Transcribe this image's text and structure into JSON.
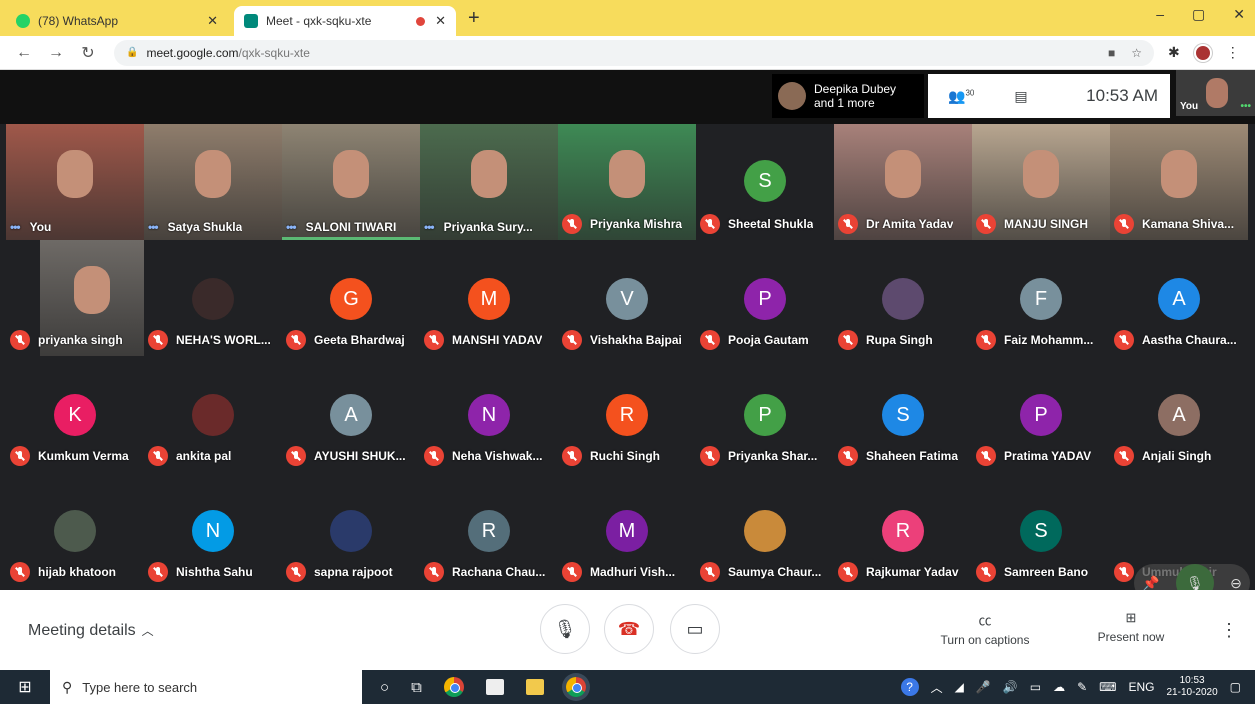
{
  "browser": {
    "tabs": [
      {
        "title": "(78) WhatsApp",
        "close": "✕",
        "color": "#25d366"
      },
      {
        "title": "Meet - qxk-sqku-xte",
        "close": "✕",
        "color": "#00897b"
      }
    ],
    "new_tab": "+",
    "url_host": "meet.google.com",
    "url_path": "/qxk-sqku-xte",
    "window_controls": [
      "–",
      "▢",
      "✕"
    ]
  },
  "meet": {
    "presenter_text": "Deepika Dubey and 1 more",
    "participants_count": "30",
    "time": "10:53 AM",
    "self_label": "You",
    "tiles": [
      {
        "name": "You",
        "type": "video",
        "bg": "#a0584a",
        "indicator": "dots"
      },
      {
        "name": "Satya Shukla",
        "type": "video",
        "bg": "#8f7d6c",
        "indicator": "dots"
      },
      {
        "name": "SALONI TIWARI",
        "type": "video",
        "bg": "#8e8473",
        "indicator": "dots",
        "speaking": true
      },
      {
        "name": "Priyanka Sury...",
        "type": "video",
        "bg": "#4c6b4e",
        "indicator": "dots"
      },
      {
        "name": "Priyanka Mishra",
        "type": "video",
        "bg": "#3e8a55",
        "indicator": "mute"
      },
      {
        "name": "Sheetal Shukla",
        "type": "avatar",
        "letter": "S",
        "color": "#43a047",
        "indicator": "mute"
      },
      {
        "name": "Dr Amita Yadav",
        "type": "video",
        "bg": "#a8817a",
        "indicator": "mute"
      },
      {
        "name": "MANJU SINGH",
        "type": "video",
        "bg": "#b8a690",
        "indicator": "mute"
      },
      {
        "name": "Kamana Shiva...",
        "type": "video",
        "bg": "#9e8b76",
        "indicator": "mute"
      },
      {
        "name": "priyanka singh",
        "type": "video",
        "bg": "#6e6a66",
        "indicator": "mute"
      },
      {
        "name": "NEHA'S WORL...",
        "type": "photo",
        "color": "#3a2a2a",
        "indicator": "mute"
      },
      {
        "name": "Geeta Bhardwaj",
        "type": "avatar",
        "letter": "G",
        "color": "#f4511e",
        "indicator": "mute"
      },
      {
        "name": "MANSHI YADAV",
        "type": "avatar",
        "letter": "M",
        "color": "#f4511e",
        "indicator": "mute"
      },
      {
        "name": "Vishakha Bajpai",
        "type": "avatar",
        "letter": "V",
        "color": "#78909c",
        "indicator": "mute"
      },
      {
        "name": "Pooja Gautam",
        "type": "avatar",
        "letter": "P",
        "color": "#8e24aa",
        "indicator": "mute"
      },
      {
        "name": "Rupa Singh",
        "type": "photo",
        "color": "#5d4a6e",
        "indicator": "mute"
      },
      {
        "name": "Faiz Mohamm...",
        "type": "avatar",
        "letter": "F",
        "color": "#78909c",
        "indicator": "mute"
      },
      {
        "name": "Aastha Chaura...",
        "type": "avatar",
        "letter": "A",
        "color": "#1e88e5",
        "indicator": "mute"
      },
      {
        "name": "Kumkum Verma",
        "type": "avatar",
        "letter": "K",
        "color": "#e91e63",
        "indicator": "mute"
      },
      {
        "name": "ankita pal",
        "type": "photo",
        "color": "#6a2a2a",
        "indicator": "mute"
      },
      {
        "name": "AYUSHI SHUK...",
        "type": "avatar",
        "letter": "A",
        "color": "#78909c",
        "indicator": "mute"
      },
      {
        "name": "Neha Vishwak...",
        "type": "avatar",
        "letter": "N",
        "color": "#8e24aa",
        "indicator": "mute"
      },
      {
        "name": "Ruchi Singh",
        "type": "avatar",
        "letter": "R",
        "color": "#f4511e",
        "indicator": "mute"
      },
      {
        "name": "Priyanka Shar...",
        "type": "avatar",
        "letter": "P",
        "color": "#43a047",
        "indicator": "mute"
      },
      {
        "name": "Shaheen Fatima",
        "type": "avatar",
        "letter": "S",
        "color": "#1e88e5",
        "indicator": "mute"
      },
      {
        "name": "Pratima YADAV",
        "type": "avatar",
        "letter": "P",
        "color": "#8e24aa",
        "indicator": "mute"
      },
      {
        "name": "Anjali Singh",
        "type": "avatar",
        "letter": "A",
        "color": "#8d6e63",
        "indicator": "mute"
      },
      {
        "name": "hijab khatoon",
        "type": "photo",
        "color": "#4d5a4d",
        "indicator": "mute"
      },
      {
        "name": "Nishtha Sahu",
        "type": "avatar",
        "letter": "N",
        "color": "#039be5",
        "indicator": "mute"
      },
      {
        "name": "sapna rajpoot",
        "type": "photo",
        "color": "#2a3a6a",
        "indicator": "mute"
      },
      {
        "name": "Rachana Chau...",
        "type": "avatar",
        "letter": "R",
        "color": "#546e7a",
        "indicator": "mute"
      },
      {
        "name": "Madhuri Vish...",
        "type": "avatar",
        "letter": "M",
        "color": "#7b1fa2",
        "indicator": "mute"
      },
      {
        "name": "Saumya Chaur...",
        "type": "photo",
        "color": "#c98a3a",
        "indicator": "mute"
      },
      {
        "name": "Rajkumar Yadav",
        "type": "avatar",
        "letter": "R",
        "color": "#ec407a",
        "indicator": "mute"
      },
      {
        "name": "Samreen Bano",
        "type": "avatar",
        "letter": "S",
        "color": "#00695c",
        "indicator": "mute"
      },
      {
        "name": "Ummul Khair",
        "type": "hover",
        "indicator": "mute"
      }
    ]
  },
  "bottom": {
    "meeting_details": "Meeting details",
    "captions": "Turn on captions",
    "present": "Present now"
  },
  "taskbar": {
    "search_placeholder": "Type here to search",
    "lang": "ENG",
    "time": "10:53",
    "date": "21-10-2020"
  }
}
